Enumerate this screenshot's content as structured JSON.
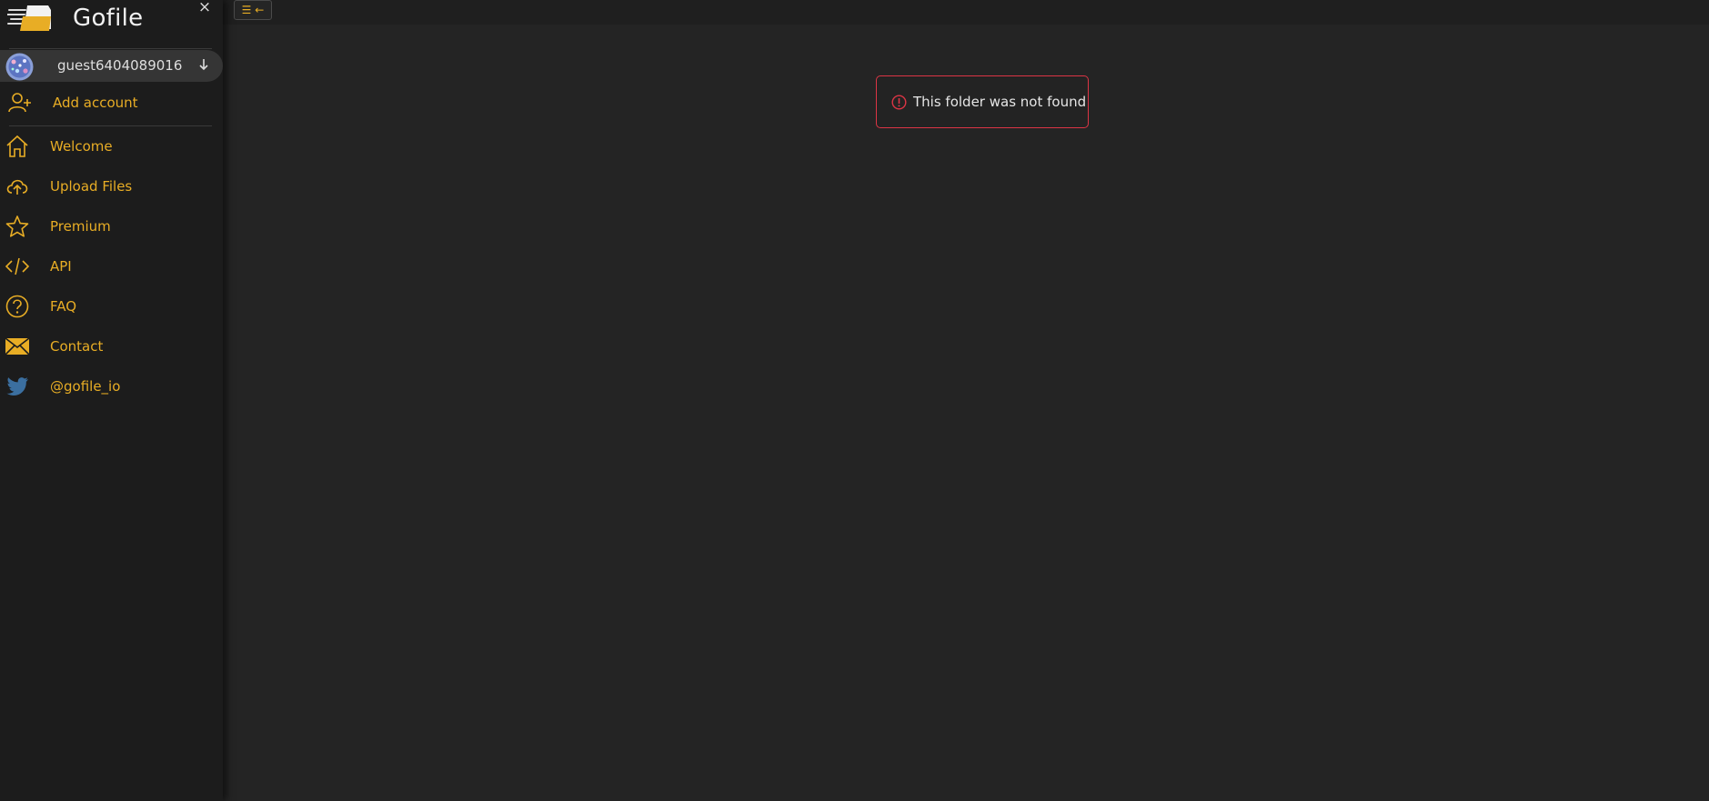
{
  "brand": {
    "name": "Gofile",
    "close_glyph": "×"
  },
  "account": {
    "username": "guest6404089016"
  },
  "add_account": {
    "label": "Add account"
  },
  "nav": [
    {
      "label": "Welcome",
      "icon": "home-icon"
    },
    {
      "label": "Upload Files",
      "icon": "cloud-upload-icon"
    },
    {
      "label": "Premium",
      "icon": "star-icon"
    },
    {
      "label": "API",
      "icon": "code-icon"
    },
    {
      "label": "FAQ",
      "icon": "question-icon"
    },
    {
      "label": "Contact",
      "icon": "envelope-icon"
    },
    {
      "label": "@gofile_io",
      "icon": "twitter-icon"
    }
  ],
  "toolbar": {
    "toggle_glyph": "☰ ←"
  },
  "alert": {
    "message": "This folder was not found"
  },
  "colors": {
    "accent": "#e8ad25",
    "sidebar_bg": "#1c1c1c",
    "main_bg": "#242424",
    "alert_border": "#dc3545",
    "twitter": "#3b6fa0"
  }
}
